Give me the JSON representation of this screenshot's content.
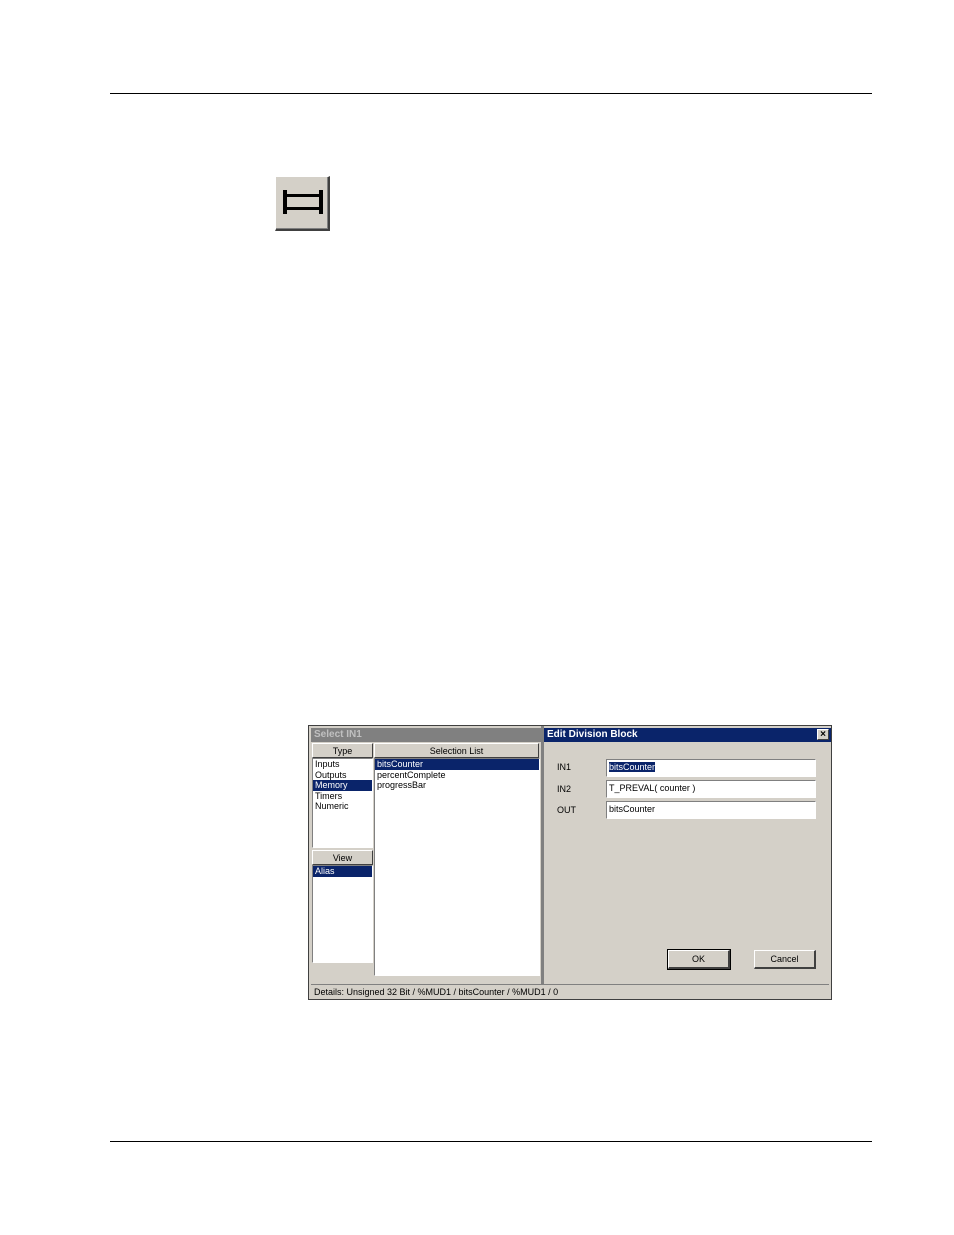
{
  "toolbar_icon": {
    "icon": "division-block-icon"
  },
  "select_dialog": {
    "title": "Select IN1",
    "type_header": "Type",
    "selection_header": "Selection List",
    "view_header": "View",
    "type_items": [
      "Inputs",
      "Outputs",
      "Memory",
      "Timers",
      "Numeric"
    ],
    "type_selected": "Memory",
    "selection_items": [
      "bitsCounter",
      "percentComplete",
      "progressBar"
    ],
    "selection_selected": "bitsCounter",
    "view_items": [
      "Alias"
    ],
    "view_selected": "Alias",
    "details": "Details: Unsigned 32 Bit / %MUD1 / bitsCounter / %MUD1 / 0"
  },
  "edit_dialog": {
    "title": "Edit Division Block",
    "close_label": "×",
    "in1_label": "IN1",
    "in1_value": "bitsCounter",
    "in2_label": "IN2",
    "in2_value": "T_PREVAL( counter )",
    "out_label": "OUT",
    "out_value": "bitsCounter",
    "ok_label": "OK",
    "cancel_label": "Cancel"
  },
  "colors": {
    "title_active": "#0a246a",
    "title_inactive": "#808080",
    "face": "#d4d0c8",
    "selection": "#0a246a"
  }
}
